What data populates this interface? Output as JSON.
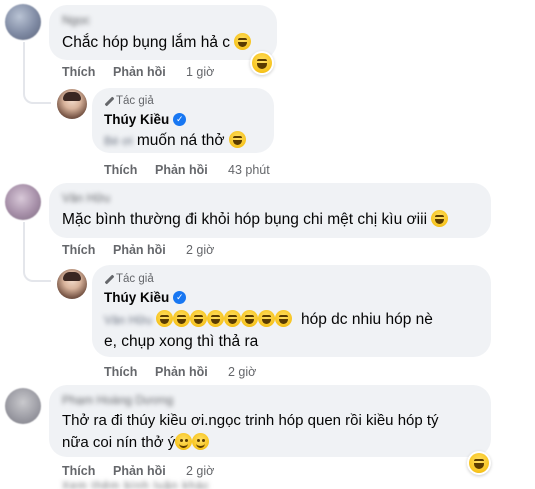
{
  "comments": [
    {
      "text": "Chắc hóp bụng lắm hả c",
      "like": "Thích",
      "reply": "Phản hồi",
      "time": "1 giờ",
      "name_blur": "Ngọc"
    },
    {
      "author_tag": "Tác giả",
      "author_name": "Thúy Kiều",
      "text": "muốn ná thở",
      "mention_blur": "Bé ơi",
      "like": "Thích",
      "reply": "Phản hồi",
      "time": "43 phút"
    },
    {
      "name_blur": "Vân Hữu",
      "text": "Mặc bình thường đi khỏi hóp bụng chi mệt chị kìu ơiii",
      "like": "Thích",
      "reply": "Phản hồi",
      "time": "2 giờ"
    },
    {
      "author_tag": "Tác giả",
      "author_name": "Thúy Kiều",
      "mention_blur": "Vân Hữu",
      "text_line1": "hóp dc nhiu hóp nè",
      "text_line2": "e, chụp xong thì thả ra",
      "like": "Thích",
      "reply": "Phản hồi",
      "time": "2 giờ"
    },
    {
      "name_blur": "Phạm Hoàng Dương",
      "text_line1": "Thở ra đi thúy kiều ơi.ngọc trinh hóp quen rồi kiều hóp tý",
      "text_line2": "nữa coi nín thở ý",
      "like": "Thích",
      "reply": "Phản hồi",
      "time": "2 giờ"
    }
  ],
  "footer_blur": "Xem thêm bình luận khác",
  "colors": {
    "bubble": "#f0f2f5",
    "verified": "#1877f2",
    "muted": "#65676b"
  },
  "icons": [
    "laughing-emoji",
    "rofl-emoji",
    "smile-emoji",
    "verified-badge-icon",
    "pen-icon"
  ]
}
